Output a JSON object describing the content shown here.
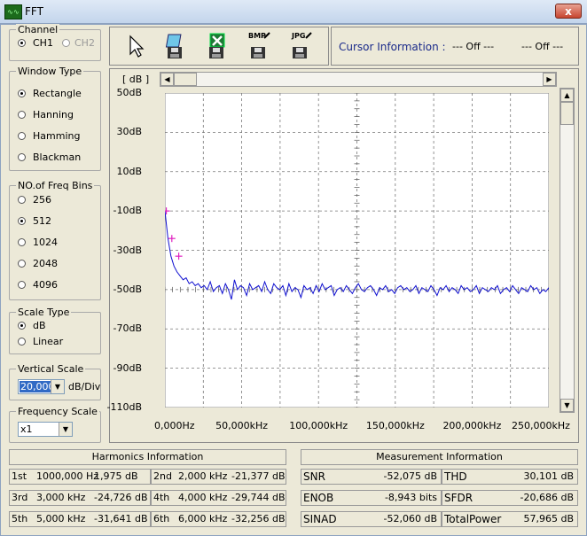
{
  "window": {
    "title": "FFT",
    "close_symbol": "x"
  },
  "channel": {
    "title": "Channel",
    "options": [
      {
        "label": "CH1",
        "selected": true,
        "enabled": true
      },
      {
        "label": "CH2",
        "selected": false,
        "enabled": false
      }
    ]
  },
  "window_type": {
    "title": "Window Type",
    "options": [
      {
        "label": "Rectangle",
        "selected": true
      },
      {
        "label": "Hanning",
        "selected": false
      },
      {
        "label": "Hamming",
        "selected": false
      },
      {
        "label": "Blackman",
        "selected": false
      }
    ]
  },
  "freq_bins": {
    "title": "NO.of Freq Bins",
    "options": [
      {
        "label": "256",
        "selected": false
      },
      {
        "label": "512",
        "selected": true
      },
      {
        "label": "1024",
        "selected": false
      },
      {
        "label": "2048",
        "selected": false
      },
      {
        "label": "4096",
        "selected": false
      }
    ]
  },
  "scale_type": {
    "title": "Scale Type",
    "options": [
      {
        "label": "dB",
        "selected": true
      },
      {
        "label": "Linear",
        "selected": false
      }
    ]
  },
  "vertical_scale": {
    "title": "Vertical Scale",
    "value": "20,000",
    "unit": "dB/Div"
  },
  "frequency_scale": {
    "title": "Frequency Scale",
    "value": "x1"
  },
  "toolbar": {
    "buttons": [
      {
        "name": "pointer",
        "label": ""
      },
      {
        "name": "save",
        "label": ""
      },
      {
        "name": "export-excel",
        "label": ""
      },
      {
        "name": "save-bmp",
        "label": "BMP"
      },
      {
        "name": "save-jpg",
        "label": "JPG"
      }
    ]
  },
  "cursor": {
    "label": "Cursor Information :",
    "value1": "--- Off ---",
    "value2": "--- Off ---"
  },
  "chart_unit": "[ dB ]",
  "chart_data": {
    "type": "line",
    "ylabel": "[ dB ]",
    "ylim": [
      -110,
      50
    ],
    "xlim": [
      0,
      250
    ],
    "y_ticks": [
      "50dB",
      "30dB",
      "10dB",
      "-10dB",
      "-30dB",
      "-50dB",
      "-70dB",
      "-90dB",
      "-110dB"
    ],
    "x_ticks": [
      "0,000Hz",
      "50,000kHz",
      "100,000kHz",
      "150,000kHz",
      "200,000kHz",
      "250,000kHz"
    ],
    "grid": true,
    "line_color": "#1010d0",
    "marker_color": "#e020c0",
    "series": [
      {
        "values": [
          -10,
          -24,
          -33,
          -38,
          -41,
          -43,
          -45,
          -44,
          -47,
          -46,
          -48,
          -47,
          -49,
          -48,
          -50,
          -46,
          -51,
          -49,
          -48,
          -52,
          -47,
          -50,
          -55,
          -45,
          -50,
          -48,
          -49,
          -53,
          -47,
          -50,
          -49,
          -48,
          -51,
          -46,
          -50,
          -52,
          -47,
          -49,
          -50,
          -48,
          -53,
          -47,
          -51,
          -49,
          -50,
          -54,
          -48,
          -50,
          -49,
          -52,
          -48,
          -51,
          -47,
          -50,
          -49,
          -48,
          -53,
          -50,
          -49,
          -51,
          -48,
          -50,
          -52,
          -49,
          -47,
          -50,
          -51,
          -49,
          -48,
          -50,
          -53,
          -49,
          -50,
          -48,
          -51,
          -50,
          -52,
          -49,
          -48,
          -50,
          -49,
          -51,
          -50,
          -48,
          -52,
          -49,
          -50,
          -51,
          -48,
          -50,
          -53,
          -49,
          -50,
          -48,
          -51,
          -49,
          -50,
          -52,
          -48,
          -50,
          -49,
          -51,
          -50,
          -48,
          -52,
          -49,
          -50,
          -51,
          -49,
          -50,
          -48,
          -52,
          -50,
          -49,
          -51,
          -48,
          -50,
          -52,
          -49,
          -50,
          -51,
          -48,
          -50,
          -49,
          -52,
          -50,
          -51,
          -49
        ]
      }
    ],
    "markers": [
      {
        "x": 0.9,
        "y": -10
      },
      {
        "x": 4.5,
        "y": -24
      },
      {
        "x": 9,
        "y": -33
      }
    ]
  },
  "harmonics": {
    "title": "Harmonics Information",
    "rows": [
      [
        {
          "order": "1st",
          "freq": "1000,000 Hz",
          "db": "1,975 dB"
        },
        {
          "order": "2nd",
          "freq": "2,000 kHz",
          "db": "-21,377 dB"
        }
      ],
      [
        {
          "order": "3rd",
          "freq": "3,000 kHz",
          "db": "-24,726 dB"
        },
        {
          "order": "4th",
          "freq": "4,000 kHz",
          "db": "-29,744 dB"
        }
      ],
      [
        {
          "order": "5th",
          "freq": "5,000 kHz",
          "db": "-31,641 dB"
        },
        {
          "order": "6th",
          "freq": "6,000 kHz",
          "db": "-32,256 dB"
        }
      ]
    ]
  },
  "measurement": {
    "title": "Measurement Information",
    "rows": [
      [
        {
          "name": "SNR",
          "value": "-52,075 dB"
        },
        {
          "name": "THD",
          "value": "30,101 dB"
        }
      ],
      [
        {
          "name": "ENOB",
          "value": "-8,943 bits"
        },
        {
          "name": "SFDR",
          "value": "-20,686 dB"
        }
      ],
      [
        {
          "name": "SINAD",
          "value": "-52,060 dB"
        },
        {
          "name": "TotalPower",
          "value": "57,965 dB"
        }
      ]
    ]
  }
}
